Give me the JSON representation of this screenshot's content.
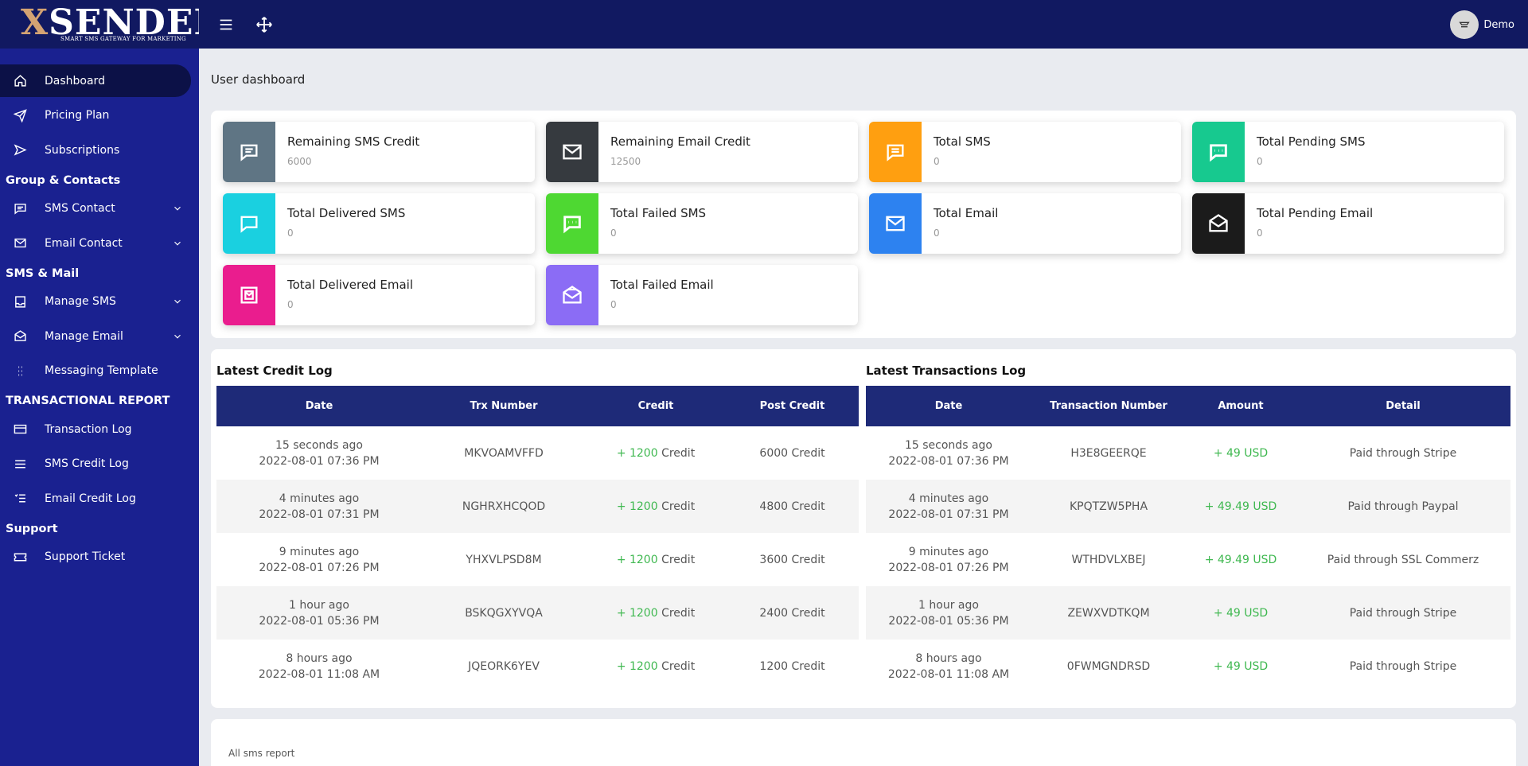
{
  "brand": {
    "name_x": "X",
    "name_rest": "SENDER",
    "tagline": "SMART SMS GATEWAY FOR MARKETING"
  },
  "user": {
    "name": "Demo"
  },
  "sidebar": {
    "items": [
      {
        "label": "Dashboard",
        "icon": "home-icon"
      },
      {
        "label": "Pricing Plan",
        "icon": "send-icon"
      },
      {
        "label": "Subscriptions",
        "icon": "arrow-send-icon"
      }
    ],
    "group_contacts": {
      "heading": "Group & Contacts",
      "items": [
        {
          "label": "SMS Contact",
          "icon": "message-icon"
        },
        {
          "label": "Email Contact",
          "icon": "mail-icon"
        }
      ]
    },
    "sms_mail": {
      "heading": "SMS & Mail",
      "items": [
        {
          "label": "Manage SMS",
          "icon": "inbox-icon"
        },
        {
          "label": "Manage Email",
          "icon": "mail-open-icon"
        },
        {
          "label": "Messaging Template",
          "icon": "grid-dots-icon"
        }
      ]
    },
    "report": {
      "heading": "TRANSACTIONAL REPORT",
      "items": [
        {
          "label": "Transaction Log",
          "icon": "card-icon"
        },
        {
          "label": "SMS Credit Log",
          "icon": "list-icon"
        },
        {
          "label": "Email Credit Log",
          "icon": "checklist-icon"
        }
      ]
    },
    "support": {
      "heading": "Support",
      "items": [
        {
          "label": "Support Ticket",
          "icon": "ticket-icon"
        }
      ]
    }
  },
  "page_title": "User dashboard",
  "cards": [
    {
      "title": "Remaining SMS Credit",
      "value": "6000",
      "color": "#5f7584"
    },
    {
      "title": "Remaining Email Credit",
      "value": "12500",
      "color": "#363a3f"
    },
    {
      "title": "Total SMS",
      "value": "0",
      "color": "#ff9f10"
    },
    {
      "title": "Total Pending SMS",
      "value": "0",
      "color": "#17c98f"
    },
    {
      "title": "Total Delivered SMS",
      "value": "0",
      "color": "#1ad0e0"
    },
    {
      "title": "Total Failed SMS",
      "value": "0",
      "color": "#4ed832"
    },
    {
      "title": "Total Email",
      "value": "0",
      "color": "#2d82f0"
    },
    {
      "title": "Total Pending Email",
      "value": "0",
      "color": "#1b1b1b"
    },
    {
      "title": "Total Delivered Email",
      "value": "0",
      "color": "#ea1d8e"
    },
    {
      "title": "Total Failed Email",
      "value": "0",
      "color": "#8b6cf5"
    }
  ],
  "credit_log": {
    "title": "Latest Credit Log",
    "headers": [
      "Date",
      "Trx Number",
      "Credit",
      "Post Credit"
    ],
    "credit_unit": "Credit",
    "rows": [
      {
        "ago": "15 seconds ago",
        "date": "2022-08-01 07:36 PM",
        "trx": "MKVOAMVFFD",
        "credit": "+ 1200",
        "post": "6000 Credit"
      },
      {
        "ago": "4 minutes ago",
        "date": "2022-08-01 07:31 PM",
        "trx": "NGHRXHCQOD",
        "credit": "+ 1200",
        "post": "4800 Credit"
      },
      {
        "ago": "9 minutes ago",
        "date": "2022-08-01 07:26 PM",
        "trx": "YHXVLPSD8M",
        "credit": "+ 1200",
        "post": "3600 Credit"
      },
      {
        "ago": "1 hour ago",
        "date": "2022-08-01 05:36 PM",
        "trx": "BSKQGXYVQA",
        "credit": "+ 1200",
        "post": "2400 Credit"
      },
      {
        "ago": "8 hours ago",
        "date": "2022-08-01 11:08 AM",
        "trx": "JQEORK6YEV",
        "credit": "+ 1200",
        "post": "1200 Credit"
      }
    ]
  },
  "transactions_log": {
    "title": "Latest Transactions Log",
    "headers": [
      "Date",
      "Transaction Number",
      "Amount",
      "Detail"
    ],
    "rows": [
      {
        "ago": "15 seconds ago",
        "date": "2022-08-01 07:36 PM",
        "trx": "H3E8GEERQE",
        "amount": "+ 49 USD",
        "detail": "Paid through Stripe"
      },
      {
        "ago": "4 minutes ago",
        "date": "2022-08-01 07:31 PM",
        "trx": "KPQTZW5PHA",
        "amount": "+ 49.49 USD",
        "detail": "Paid through Paypal"
      },
      {
        "ago": "9 minutes ago",
        "date": "2022-08-01 07:26 PM",
        "trx": "WTHDVLXBEJ",
        "amount": "+ 49.49 USD",
        "detail": "Paid through SSL Commerz"
      },
      {
        "ago": "1 hour ago",
        "date": "2022-08-01 05:36 PM",
        "trx": "ZEWXVDTKQM",
        "amount": "+ 49 USD",
        "detail": "Paid through Stripe"
      },
      {
        "ago": "8 hours ago",
        "date": "2022-08-01 11:08 AM",
        "trx": "0FWMGNDRSD",
        "amount": "+ 49 USD",
        "detail": "Paid through Stripe"
      }
    ]
  },
  "report": {
    "label": "All sms report"
  }
}
